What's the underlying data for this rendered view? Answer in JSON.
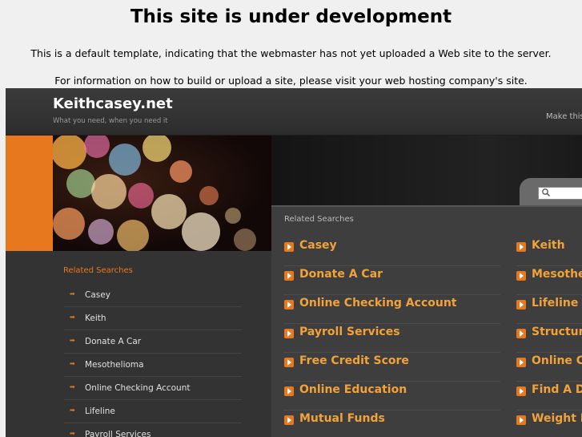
{
  "notice": {
    "title": "This site is under development",
    "line1": "This is a default template, indicating that the webmaster has not yet uploaded a Web site to the server.",
    "line2": "For information on how to build or upload a site, please visit your web hosting company's site."
  },
  "header": {
    "site_title": "Keithcasey.net",
    "tagline": "What you need, when you need it",
    "make_this": "Make this"
  },
  "sidebar": {
    "heading": "Related Searches",
    "items": [
      {
        "label": "Casey"
      },
      {
        "label": "Keith"
      },
      {
        "label": "Donate A Car"
      },
      {
        "label": "Mesothelioma"
      },
      {
        "label": "Online Checking Account"
      },
      {
        "label": "Lifeline"
      },
      {
        "label": "Payroll Services"
      }
    ]
  },
  "results": {
    "heading": "Related Searches",
    "left": [
      {
        "label": "Casey"
      },
      {
        "label": "Donate A Car"
      },
      {
        "label": "Online Checking Account"
      },
      {
        "label": "Payroll Services"
      },
      {
        "label": "Free Credit Score"
      },
      {
        "label": "Online Education"
      },
      {
        "label": "Mutual Funds"
      }
    ],
    "right": [
      {
        "label": "Keith"
      },
      {
        "label": "Mesothel"
      },
      {
        "label": "Lifeline"
      },
      {
        "label": "Structure"
      },
      {
        "label": "Online Co"
      },
      {
        "label": "Find A De"
      },
      {
        "label": "Weight Lo"
      }
    ]
  },
  "colors": {
    "accent": "#e8781e",
    "link": "#f2a23a",
    "background": "#262626"
  }
}
